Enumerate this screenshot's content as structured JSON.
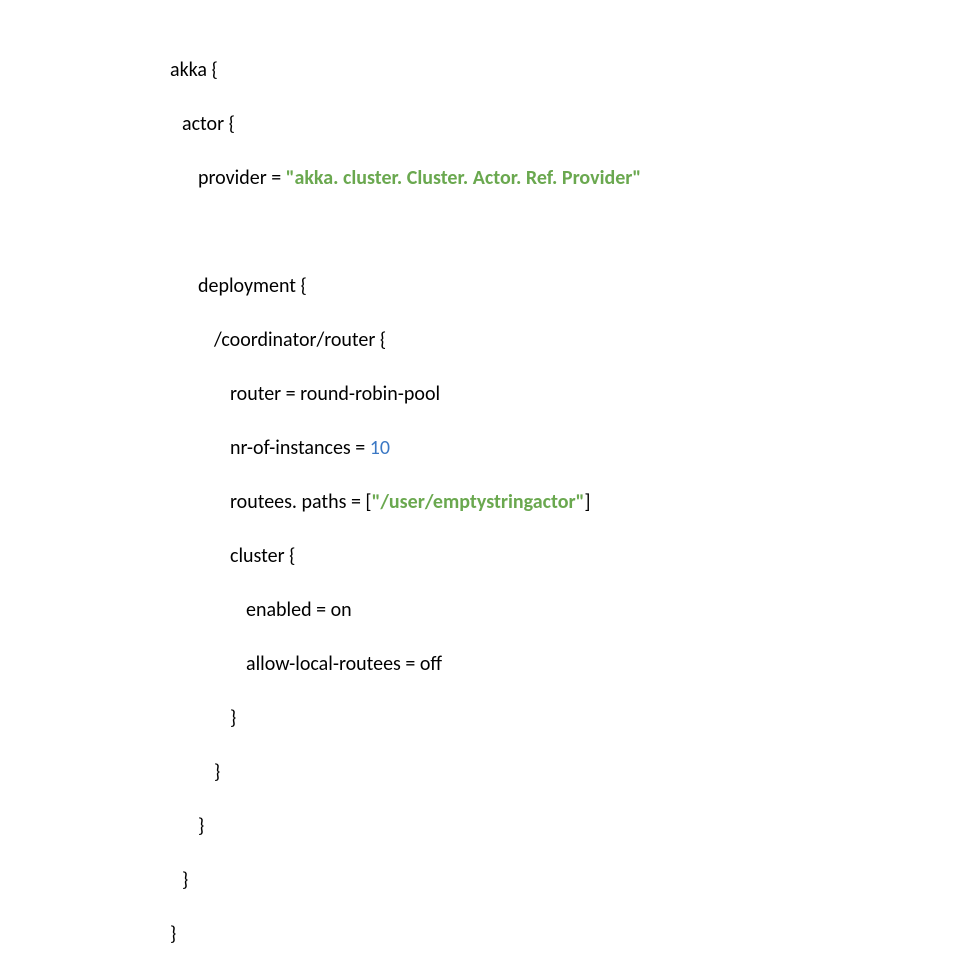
{
  "code": {
    "line1": "akka {",
    "line2": "actor {",
    "line3a": "provider = ",
    "line3b": "\"akka. cluster. Cluster. Actor. Ref. Provider\"",
    "line4": "deployment {",
    "line5": "/coordinator/router {",
    "line6": "router = round-robin-pool",
    "line7a": "nr-of-instances = ",
    "line7b": "10",
    "line8a": "routees. paths",
    "line8b": " = [",
    "line8c": "\"/user/emptystringactor\"",
    "line8d": "]",
    "line9": "cluster {",
    "line10": "enabled = on",
    "line11": "allow-local-routees = off",
    "line12": "}",
    "line13": "}",
    "line14": "}",
    "line15": "}",
    "line16": "}"
  }
}
